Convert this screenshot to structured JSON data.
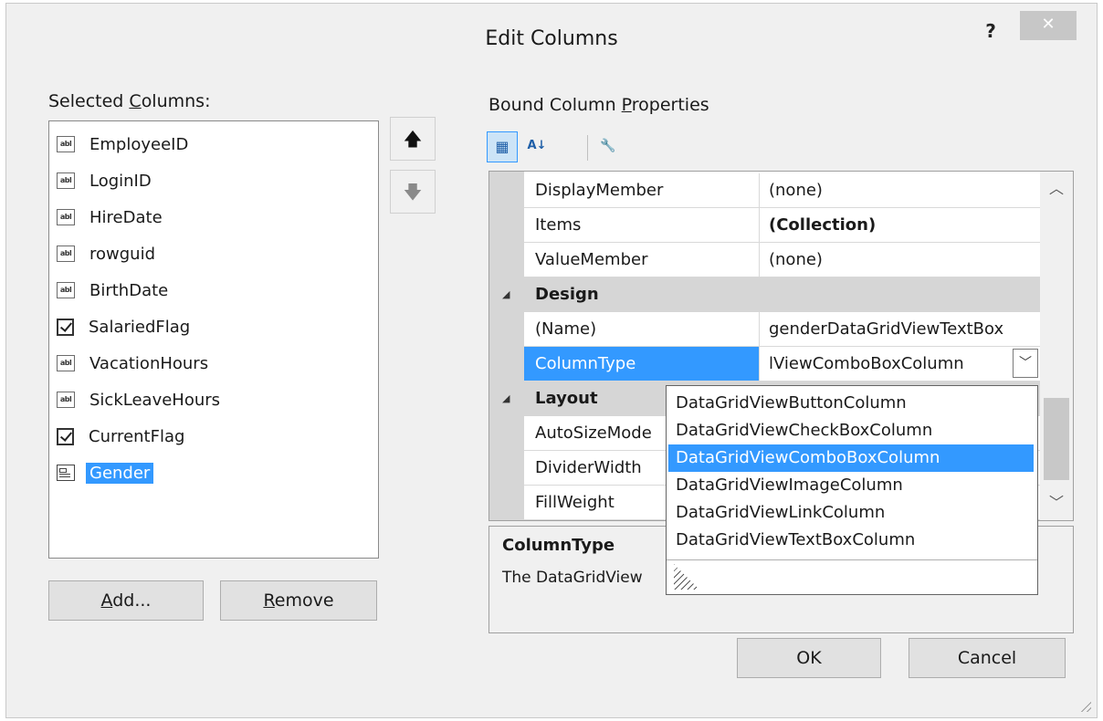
{
  "window": {
    "title": "Edit Columns",
    "help_label": "?",
    "close_label": "✕"
  },
  "selected_columns": {
    "label_prefix": "Selected ",
    "label_key": "C",
    "label_suffix": "olumns:",
    "items": [
      {
        "name": "EmployeeID",
        "icon": "textbox-column-icon",
        "icon_text": "abl"
      },
      {
        "name": "LoginID",
        "icon": "textbox-column-icon",
        "icon_text": "abl"
      },
      {
        "name": "HireDate",
        "icon": "textbox-column-icon",
        "icon_text": "abl"
      },
      {
        "name": "rowguid",
        "icon": "textbox-column-icon",
        "icon_text": "abl"
      },
      {
        "name": "BirthDate",
        "icon": "textbox-column-icon",
        "icon_text": "abl"
      },
      {
        "name": "SalariedFlag",
        "icon": "checkbox-column-icon",
        "icon_text": ""
      },
      {
        "name": "VacationHours",
        "icon": "textbox-column-icon",
        "icon_text": "abl"
      },
      {
        "name": "SickLeaveHours",
        "icon": "textbox-column-icon",
        "icon_text": "abl"
      },
      {
        "name": "CurrentFlag",
        "icon": "checkbox-column-icon",
        "icon_text": ""
      },
      {
        "name": "Gender",
        "icon": "combobox-column-icon",
        "icon_text": "",
        "selected": true
      }
    ],
    "move_up_icon": "🡅",
    "move_down_icon": "🡇"
  },
  "buttons": {
    "add_key": "A",
    "add_rest": "dd...",
    "remove_key": "R",
    "remove_rest": "emove",
    "ok": "OK",
    "cancel": "Cancel"
  },
  "properties": {
    "label_prefix": "Bound Column ",
    "label_key": "P",
    "label_suffix": "roperties",
    "toolbar": {
      "categorized_icon": "categorized-icon",
      "categorized_glyph": "▦",
      "alphabetical_icon": "sort-alphabetical-icon",
      "alphabetical_glyph": "A↓",
      "property_pages_icon": "wrench-icon",
      "property_pages_glyph": "🔧"
    },
    "rows_top": [
      {
        "name": "DisplayMember",
        "value": "(none)"
      },
      {
        "name": "Items",
        "value": "(Collection)",
        "bold": true
      },
      {
        "name": "ValueMember",
        "value": "(none)"
      }
    ],
    "design_category": "Design",
    "design_rows": [
      {
        "name": "(Name)",
        "value": "genderDataGridViewTextBox"
      },
      {
        "name": "ColumnType",
        "value": "lViewComboBoxColumn",
        "selected": true
      }
    ],
    "layout_category": "Layout",
    "layout_rows": [
      {
        "name": "AutoSizeMode",
        "value": ""
      },
      {
        "name": "DividerWidth",
        "value": ""
      },
      {
        "name": "FillWeight",
        "value": ""
      }
    ],
    "collapse_glyph": "◢",
    "scroll_up": "︿",
    "scroll_down": "﹀",
    "dropdown_glyph": "﹀"
  },
  "column_type_dropdown": {
    "options": [
      "DataGridViewButtonColumn",
      "DataGridViewCheckBoxColumn",
      "DataGridViewComboBoxColumn",
      "DataGridViewImageColumn",
      "DataGridViewLinkColumn",
      "DataGridViewTextBoxColumn"
    ],
    "selected_index": 2
  },
  "description": {
    "title": "ColumnType",
    "text": "The DataGridView"
  }
}
